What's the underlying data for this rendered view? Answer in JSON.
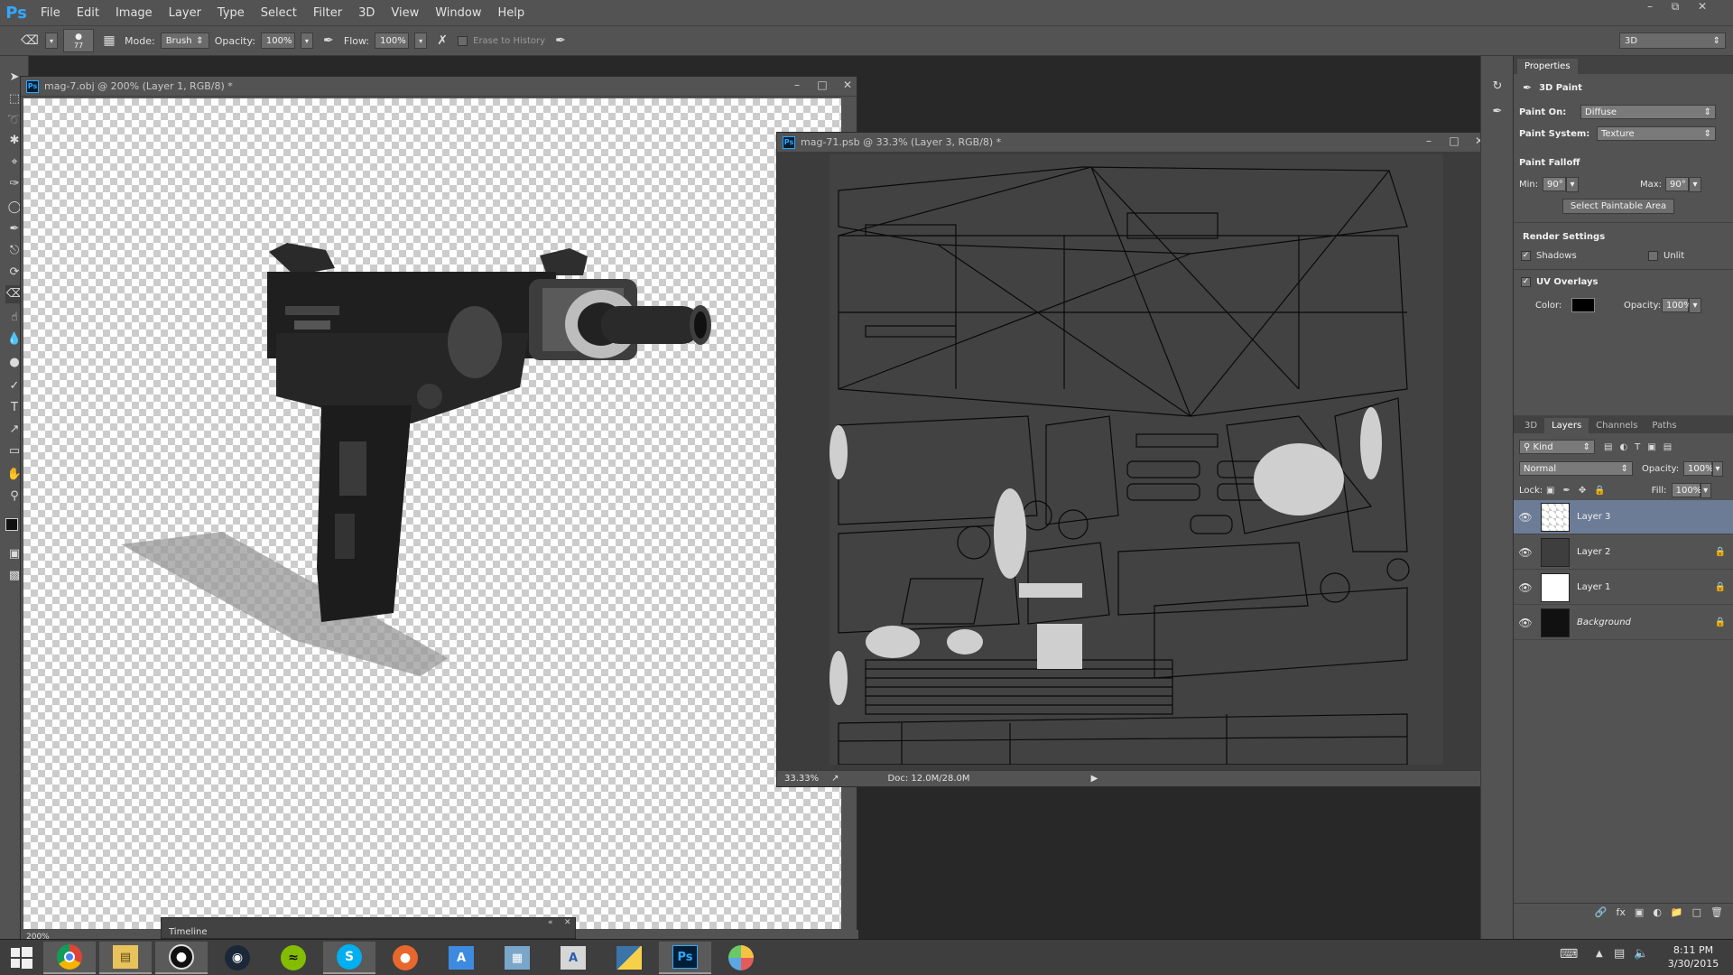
{
  "app": {
    "logo": "Ps",
    "accent": "#31a8ff"
  },
  "menu": [
    "File",
    "Edit",
    "Image",
    "Layer",
    "Type",
    "Select",
    "Filter",
    "3D",
    "View",
    "Window",
    "Help"
  ],
  "options": {
    "brush_size": "77",
    "mode_label": "Mode:",
    "mode_value": "Brush",
    "opacity_label": "Opacity:",
    "opacity_value": "100%",
    "flow_label": "Flow:",
    "flow_value": "100%",
    "erase_history_label": "Erase to History",
    "workspace": "3D"
  },
  "doc1": {
    "title": "mag-7.obj @ 200% (Layer 1, RGB/8) *",
    "zoom": "200%"
  },
  "timeline": {
    "label": "Timeline"
  },
  "doc2": {
    "title": "mag-71.psb @ 33.3% (Layer 3, RGB/8) *",
    "zoom": "33.33%",
    "doc_info": "Doc: 12.0M/28.0M"
  },
  "properties": {
    "panel_title": "Properties",
    "header": "3D Paint",
    "paint_on_label": "Paint On:",
    "paint_on_value": "Diffuse",
    "paint_system_label": "Paint System:",
    "paint_system_value": "Texture",
    "falloff_title": "Paint Falloff",
    "min_label": "Min:",
    "min_value": "90°",
    "max_label": "Max:",
    "max_value": "90°",
    "select_paintable": "Select Paintable Area",
    "render_title": "Render Settings",
    "shadows_label": "Shadows",
    "unlit_label": "Unlit",
    "uv_label": "UV Overlays",
    "color_label": "Color:",
    "uv_color": "#000000",
    "opacity_label": "Opacity:",
    "opacity_value": "100%"
  },
  "layers_panel": {
    "tabs": [
      "3D",
      "Layers",
      "Channels",
      "Paths"
    ],
    "kind": "Kind",
    "blend": "Normal",
    "opacity_label": "Opacity:",
    "opacity_value": "100%",
    "lock_label": "Lock:",
    "fill_label": "Fill:",
    "fill_value": "100%",
    "layers": [
      {
        "name": "Layer 3",
        "selected": true
      },
      {
        "name": "Layer 2",
        "selected": false
      },
      {
        "name": "Layer 1",
        "selected": false
      },
      {
        "name": "Background",
        "selected": false
      }
    ]
  },
  "taskbar": {
    "time": "8:11 PM",
    "date": "3/30/2015"
  }
}
